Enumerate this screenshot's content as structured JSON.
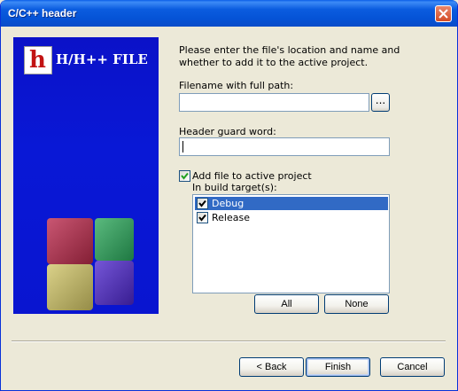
{
  "window": {
    "title": "C/C++ header"
  },
  "side_panel": {
    "logo_letter": "h",
    "title": "H/H++ FILE",
    "colors": {
      "background": "#0918d6"
    }
  },
  "intro_text_line1": "Please enter the file's location and name and",
  "intro_text_line2": "whether to add it to the active project.",
  "filename": {
    "label": "Filename with full path:",
    "value": "",
    "browse_label": "..."
  },
  "guard": {
    "label": "Header guard word:",
    "value": ""
  },
  "add_to_project": {
    "label": "Add file to active project",
    "checked": true
  },
  "build_targets": {
    "label": "In build target(s):",
    "items": [
      {
        "label": "Debug",
        "checked": true,
        "selected": true
      },
      {
        "label": "Release",
        "checked": true,
        "selected": false
      }
    ],
    "all_label": "All",
    "none_label": "None"
  },
  "footer": {
    "back_label": "< Back",
    "finish_label": "Finish",
    "cancel_label": "Cancel"
  },
  "colors": {
    "titlebar": "#0553d6",
    "selection": "#316ac5",
    "dialog_bg": "#ece9d8"
  }
}
